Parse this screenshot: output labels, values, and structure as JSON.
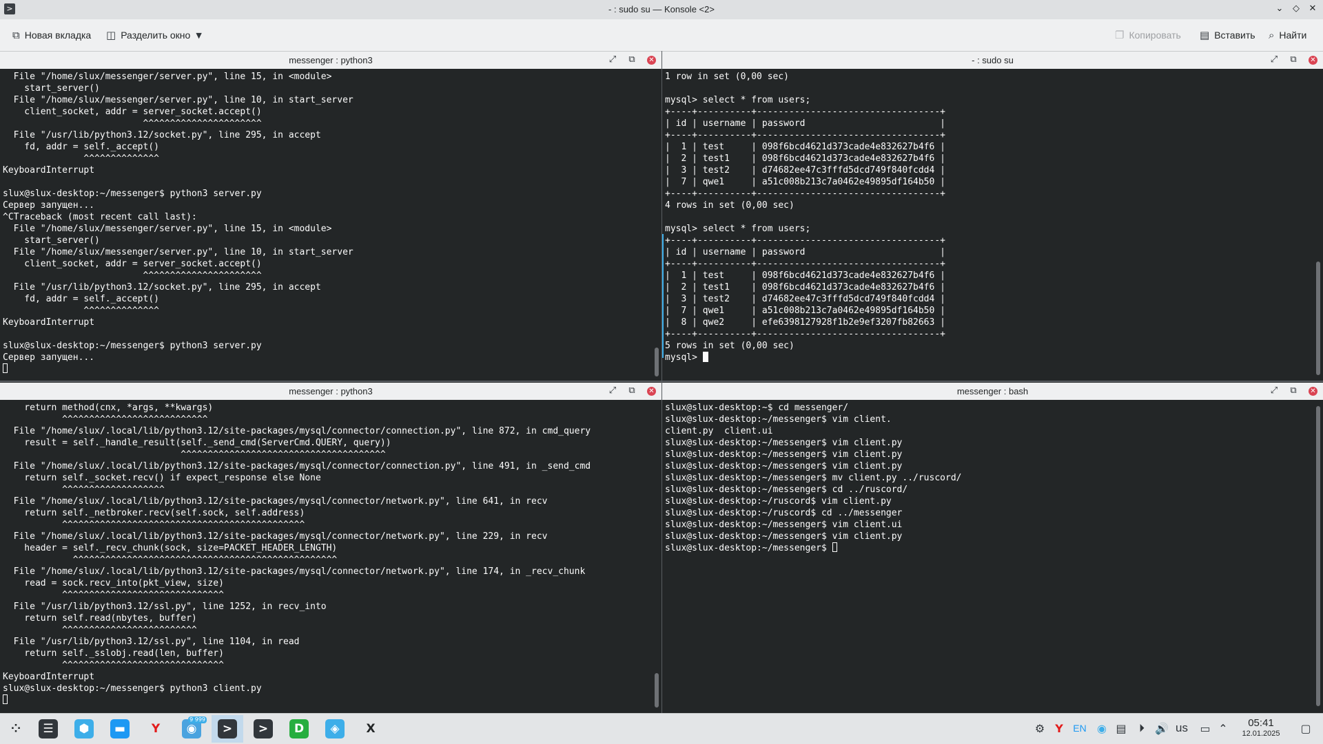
{
  "window": {
    "title": "- : sudo su — Konsole <2>",
    "app_icon": ">"
  },
  "toolbar": {
    "new_tab": "Новая вкладка",
    "split_view": "Разделить окно",
    "copy": "Копировать",
    "paste": "Вставить",
    "find": "Найти"
  },
  "panes": {
    "top_left": {
      "title": "messenger : python3",
      "text": "  File \"/home/slux/messenger/server.py\", line 15, in <module>\n    start_server()\n  File \"/home/slux/messenger/server.py\", line 10, in start_server\n    client_socket, addr = server_socket.accept()\n                          ^^^^^^^^^^^^^^^^^^^^^^\n  File \"/usr/lib/python3.12/socket.py\", line 295, in accept\n    fd, addr = self._accept()\n               ^^^^^^^^^^^^^^\nKeyboardInterrupt\n\nslux@slux-desktop:~/messenger$ python3 server.py\nСервер запущен...\n^CTraceback (most recent call last):\n  File \"/home/slux/messenger/server.py\", line 15, in <module>\n    start_server()\n  File \"/home/slux/messenger/server.py\", line 10, in start_server\n    client_socket, addr = server_socket.accept()\n                          ^^^^^^^^^^^^^^^^^^^^^^\n  File \"/usr/lib/python3.12/socket.py\", line 295, in accept\n    fd, addr = self._accept()\n               ^^^^^^^^^^^^^^\nKeyboardInterrupt\n\nslux@slux-desktop:~/messenger$ python3 server.py\nСервер запущен..."
    },
    "top_right": {
      "title": "- : sudo su",
      "text": "1 row in set (0,00 sec)\n\nmysql> select * from users;\n+----+----------+----------------------------------+\n| id | username | password                         |\n+----+----------+----------------------------------+\n|  1 | test     | 098f6bcd4621d373cade4e832627b4f6 |\n|  2 | test1    | 098f6bcd4621d373cade4e832627b4f6 |\n|  3 | test2    | d74682ee47c3fffd5dcd749f840fcdd4 |\n|  7 | qwe1     | a51c008b213c7a0462e49895df164b50 |\n+----+----------+----------------------------------+\n4 rows in set (0,00 sec)\n\nmysql> select * from users;\n+----+----------+----------------------------------+\n| id | username | password                         |\n+----+----------+----------------------------------+\n|  1 | test     | 098f6bcd4621d373cade4e832627b4f6 |\n|  2 | test1    | 098f6bcd4621d373cade4e832627b4f6 |\n|  3 | test2    | d74682ee47c3fffd5dcd749f840fcdd4 |\n|  7 | qwe1     | a51c008b213c7a0462e49895df164b50 |\n|  8 | qwe2     | efe6398127928f1b2e9ef3207fb82663 |\n+----+----------+----------------------------------+\n5 rows in set (0,00 sec)\n",
      "prompt": "mysql> "
    },
    "bottom_left": {
      "title": "messenger : python3",
      "text": "    return method(cnx, *args, **kwargs)\n           ^^^^^^^^^^^^^^^^^^^^^^^^^^^\n  File \"/home/slux/.local/lib/python3.12/site-packages/mysql/connector/connection.py\", line 872, in cmd_query\n    result = self._handle_result(self._send_cmd(ServerCmd.QUERY, query))\n                                 ^^^^^^^^^^^^^^^^^^^^^^^^^^^^^^^^^^^^^^\n  File \"/home/slux/.local/lib/python3.12/site-packages/mysql/connector/connection.py\", line 491, in _send_cmd\n    return self._socket.recv() if expect_response else None\n           ^^^^^^^^^^^^^^^^^^^\n  File \"/home/slux/.local/lib/python3.12/site-packages/mysql/connector/network.py\", line 641, in recv\n    return self._netbroker.recv(self.sock, self.address)\n           ^^^^^^^^^^^^^^^^^^^^^^^^^^^^^^^^^^^^^^^^^^^^^\n  File \"/home/slux/.local/lib/python3.12/site-packages/mysql/connector/network.py\", line 229, in recv\n    header = self._recv_chunk(sock, size=PACKET_HEADER_LENGTH)\n             ^^^^^^^^^^^^^^^^^^^^^^^^^^^^^^^^^^^^^^^^^^^^^^^^^\n  File \"/home/slux/.local/lib/python3.12/site-packages/mysql/connector/network.py\", line 174, in _recv_chunk\n    read = sock.recv_into(pkt_view, size)\n           ^^^^^^^^^^^^^^^^^^^^^^^^^^^^^^\n  File \"/usr/lib/python3.12/ssl.py\", line 1252, in recv_into\n    return self.read(nbytes, buffer)\n           ^^^^^^^^^^^^^^^^^^^^^^^^^\n  File \"/usr/lib/python3.12/ssl.py\", line 1104, in read\n    return self._sslobj.read(len, buffer)\n           ^^^^^^^^^^^^^^^^^^^^^^^^^^^^^^\nKeyboardInterrupt\nslux@slux-desktop:~/messenger$ python3 client.py"
    },
    "bottom_right": {
      "title": "messenger : bash",
      "text": "slux@slux-desktop:~$ cd messenger/\nslux@slux-desktop:~/messenger$ vim client.\nclient.py  client.ui\nslux@slux-desktop:~/messenger$ vim client.py\nslux@slux-desktop:~/messenger$ vim client.py\nslux@slux-desktop:~/messenger$ vim client.py\nslux@slux-desktop:~/messenger$ mv client.py ../ruscord/\nslux@slux-desktop:~/messenger$ cd ../ruscord/\nslux@slux-desktop:~/ruscord$ vim client.py\nslux@slux-desktop:~/ruscord$ cd ../messenger\nslux@slux-desktop:~/messenger$ vim client.ui\nslux@slux-desktop:~/messenger$ vim client.py",
      "prompt": "slux@slux-desktop:~/messenger$ "
    }
  },
  "taskbar": {
    "apps": [
      {
        "name": "app-launcher",
        "glyph": "⁘",
        "color": "#e3e5e7",
        "fg": "#232627"
      },
      {
        "name": "system-settings",
        "glyph": "☰",
        "color": "#31363b",
        "fg": "#ffffff"
      },
      {
        "name": "discover",
        "glyph": "⬢",
        "color": "#3daee9",
        "fg": "#ffffff"
      },
      {
        "name": "dolphin-files",
        "glyph": "▬",
        "color": "#1d99f3",
        "fg": "#ffffff"
      },
      {
        "name": "yandex-browser",
        "glyph": "Y",
        "color": "#e3e5e7",
        "fg": "#e21b1b"
      },
      {
        "name": "messenger",
        "glyph": "◉",
        "color": "#4aa3df",
        "fg": "#ffffff",
        "badge": "9 999"
      },
      {
        "name": "konsole",
        "glyph": ">",
        "color": "#31363b",
        "fg": "#ffffff"
      },
      {
        "name": "konsole-2",
        "glyph": ">",
        "color": "#31363b",
        "fg": "#ffffff"
      },
      {
        "name": "dbeaver",
        "glyph": "D",
        "color": "#27ae3f",
        "fg": "#ffffff"
      },
      {
        "name": "browser",
        "glyph": "◈",
        "color": "#3daee9",
        "fg": "#ffffff"
      },
      {
        "name": "x-app",
        "glyph": "X",
        "color": "#e3e5e7",
        "fg": "#232627"
      }
    ],
    "tray": {
      "keyboard_layout": "EN",
      "locale": "us"
    },
    "clock": {
      "time": "05:41",
      "date": "12.01.2025"
    }
  }
}
